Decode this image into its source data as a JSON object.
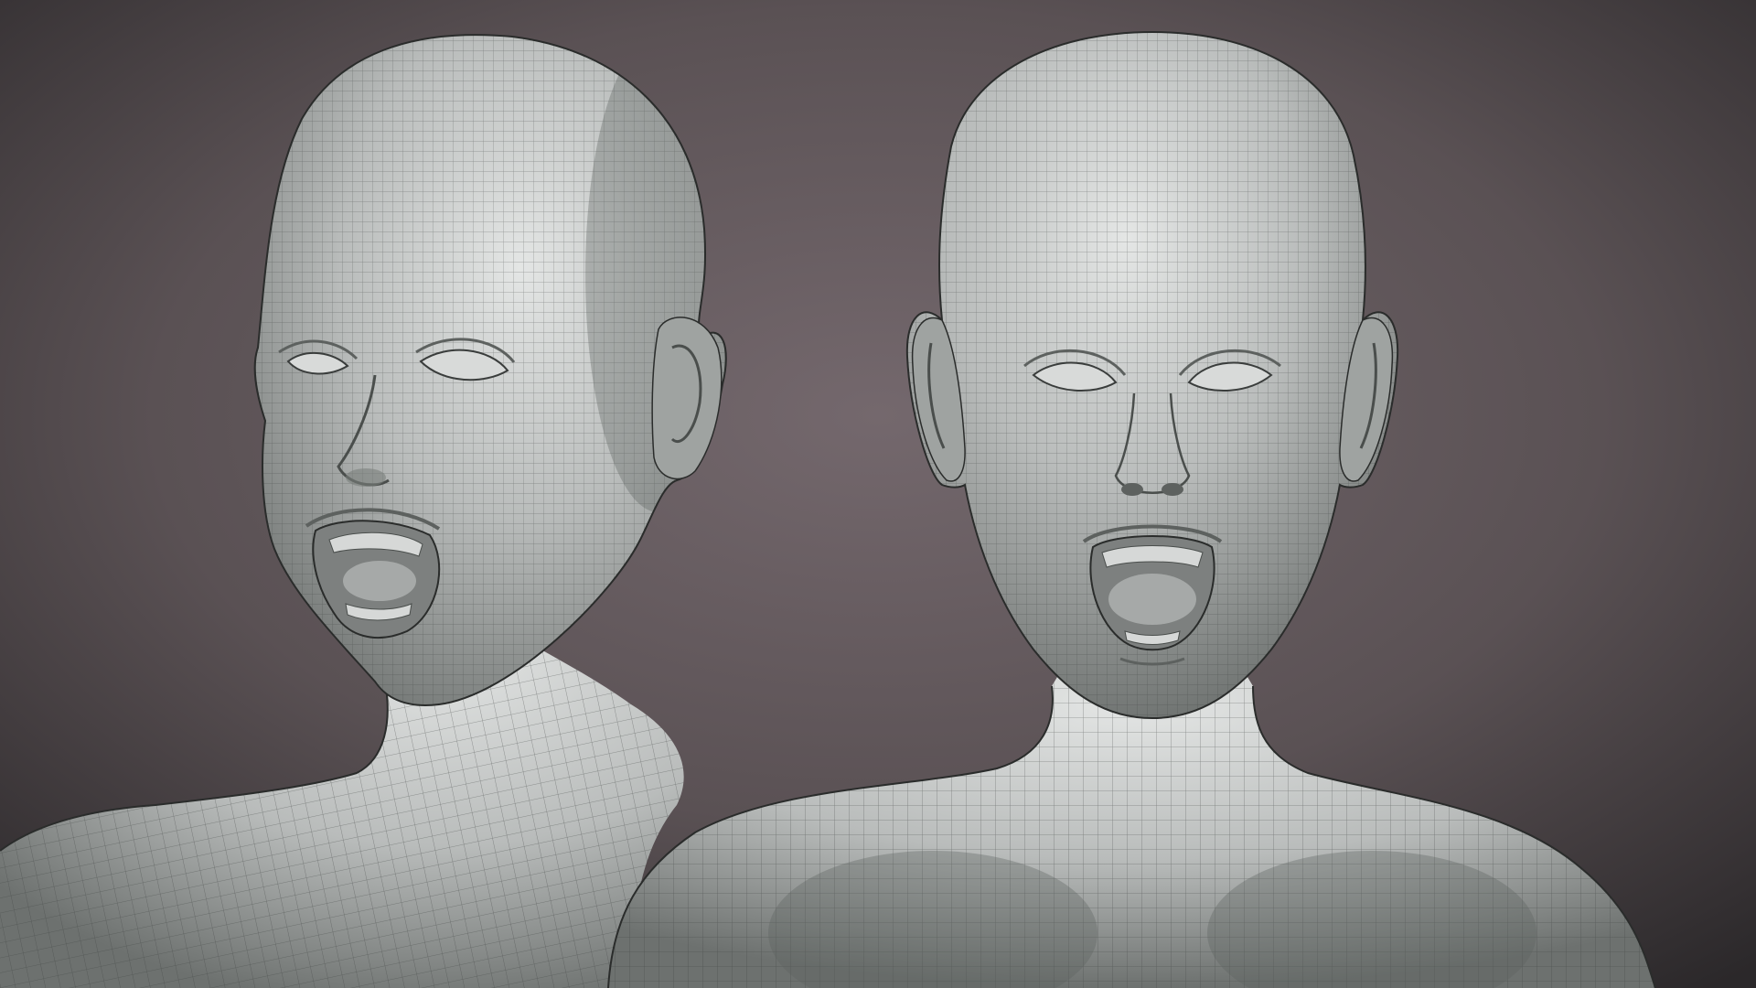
{
  "scene": {
    "background_center_color": "#74686d",
    "background_edge_color": "#2b282a",
    "mesh_base_color": "#b9bcbb",
    "mesh_shadow_color": "#6d716f",
    "mesh_highlight_color": "#e4e6e5",
    "wire_color": "#3c403e",
    "mouth_interior_color": "#8d8f8e",
    "teeth_color": "#d6d8d7"
  },
  "models": [
    {
      "id": "three-quarter-view",
      "view": "three-quarter",
      "expression": "mouth-open"
    },
    {
      "id": "front-view",
      "view": "front",
      "expression": "mouth-open"
    }
  ]
}
